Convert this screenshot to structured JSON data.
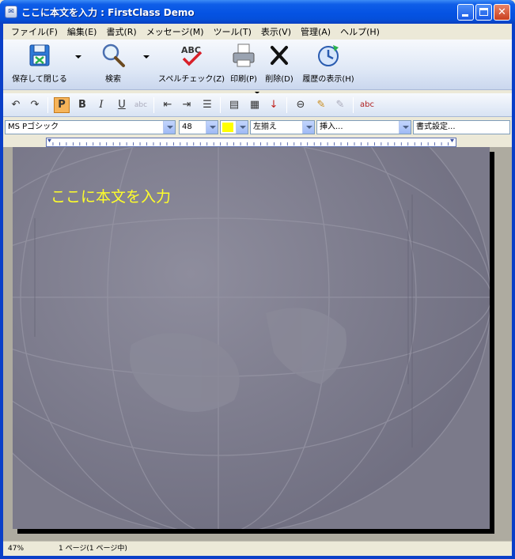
{
  "window": {
    "title": "ここに本文を入力 : FirstClass Demo",
    "app_icon": "firstclass-app-icon"
  },
  "menubar": {
    "items": [
      "ファイル(F)",
      "編集(E)",
      "書式(R)",
      "メッセージ(M)",
      "ツール(T)",
      "表示(V)",
      "管理(A)",
      "ヘルプ(H)"
    ]
  },
  "toolbar": {
    "save_close": "保存して閉じる",
    "search": "検索",
    "spell_check": "スペルチェック(Z)",
    "print": "印刷(P)",
    "delete": "削除(D)",
    "history": "履歴の表示(H)"
  },
  "format_bar": {
    "bold": "B",
    "italic": "I",
    "underline": "U",
    "bold_active": true
  },
  "combos": {
    "font_family": "MS Pゴシック",
    "font_size": "48",
    "color": "#ffff00",
    "alignment": "左揃え",
    "insert": "挿入...",
    "format_settings": "書式設定..."
  },
  "document": {
    "body_text": "ここに本文を入力"
  },
  "status": {
    "zoom": "47%",
    "page": "1 ページ(1 ページ中)"
  },
  "colors": {
    "title_bar": "#0553e3",
    "close_button": "#c9401f",
    "text_highlight": "#ffff2a",
    "page_background": "#7d7c8c"
  }
}
